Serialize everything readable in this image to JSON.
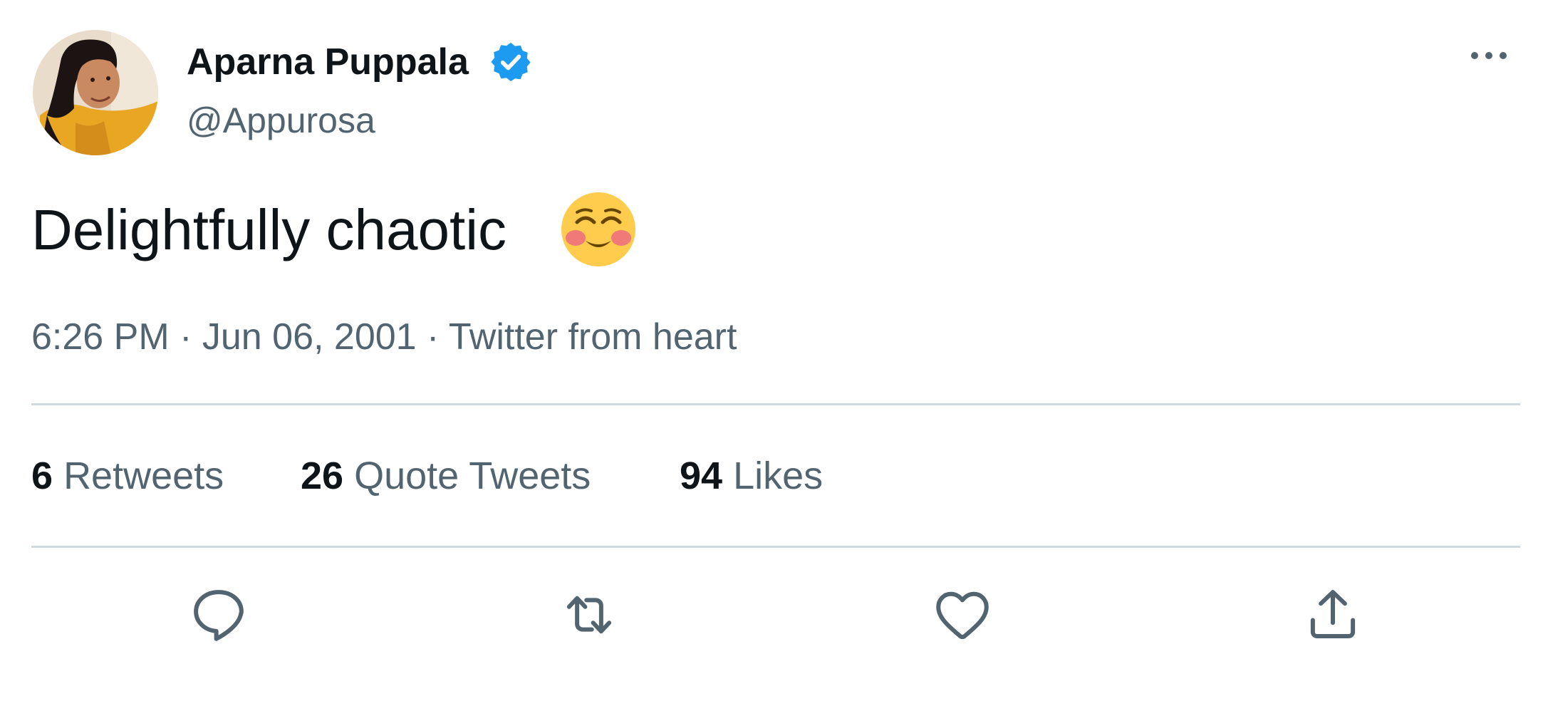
{
  "author": {
    "display_name": "Aparna Puppala",
    "handle": "@Appurosa",
    "verified": true,
    "verified_color": "#1d9bf0"
  },
  "tweet": {
    "text": "Delightfully chaotic",
    "emoji": "smiling-face-with-blush",
    "time": "6:26 PM",
    "date": "Jun 06, 2001",
    "separator": "·",
    "source": "Twitter from heart"
  },
  "stats": {
    "retweets": {
      "count": "6",
      "label": "Retweets"
    },
    "quote_tweets": {
      "count": "26",
      "label": "Quote Tweets"
    },
    "likes": {
      "count": "94",
      "label": "Likes"
    }
  },
  "actions": [
    {
      "name": "reply",
      "icon": "reply-icon"
    },
    {
      "name": "retweet",
      "icon": "retweet-icon"
    },
    {
      "name": "like",
      "icon": "heart-icon"
    },
    {
      "name": "share",
      "icon": "share-icon"
    }
  ],
  "colors": {
    "primary_text": "#0f1419",
    "secondary_text": "#536471",
    "divider": "#cfd9de",
    "accent": "#1d9bf0"
  }
}
